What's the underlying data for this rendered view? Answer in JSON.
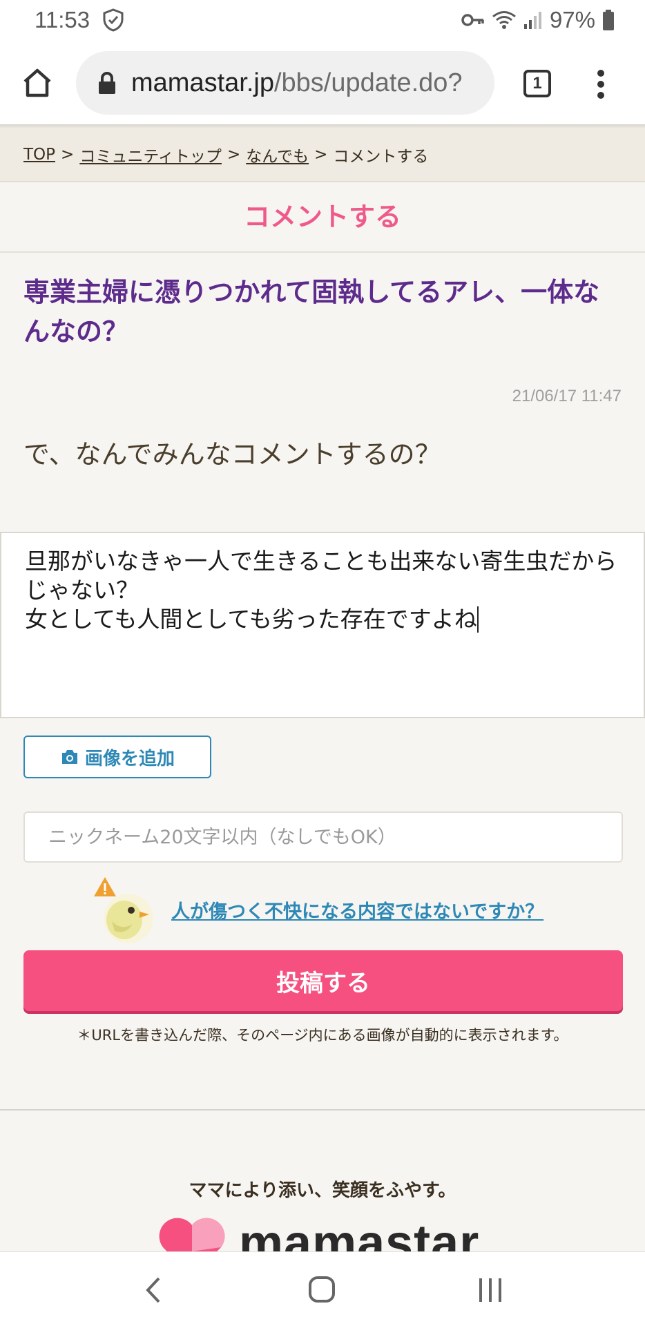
{
  "status_bar": {
    "time": "11:53",
    "battery": "97%"
  },
  "browser": {
    "url_host": "mamastar.jp",
    "url_path": "/bbs/update.do?",
    "tab_count": "1"
  },
  "breadcrumb": {
    "items": [
      "TOP",
      "コミュニティトップ",
      "なんでも"
    ],
    "current": "コメントする",
    "separator": ">"
  },
  "page": {
    "heading": "コメントする",
    "topic_title": "専業主婦に憑りつかれて固執してるアレ、一体なんなの？",
    "topic_date": "21/06/17 11:47",
    "topic_body": "で、なんでみんなコメントするの？"
  },
  "form": {
    "comment_text": "旦那がいなきゃ一人で生きることも出来ない寄生虫だからじゃない？\n女としても人間としても劣った存在ですよね",
    "add_image_label": "画像を追加",
    "nickname_placeholder": "ニックネーム20文字以内（なしでもOK）",
    "warning_link": "人が傷つく不快になる内容ではないですか？",
    "submit_label": "投稿する",
    "url_note": "＊URLを書き込んだ際、そのページ内にある画像が自動的に表示されます。"
  },
  "footer": {
    "tagline": "ママにより添い、笑顔をふやす。",
    "logo_text": "mamastar"
  },
  "colors": {
    "heading_pink": "#ee5a8a",
    "title_purple": "#5d2b8c",
    "link_blue": "#2e88b6",
    "submit_pink": "#f5507f"
  },
  "icons": [
    "shield-icon",
    "key-icon",
    "wifi-icon",
    "signal-icon",
    "battery-icon",
    "home-icon",
    "lock-icon",
    "tabs-icon",
    "more-vert-icon",
    "camera-icon",
    "warning-bird-icon",
    "heart-logo-icon",
    "back-icon",
    "home-nav-icon",
    "recent-apps-icon"
  ]
}
